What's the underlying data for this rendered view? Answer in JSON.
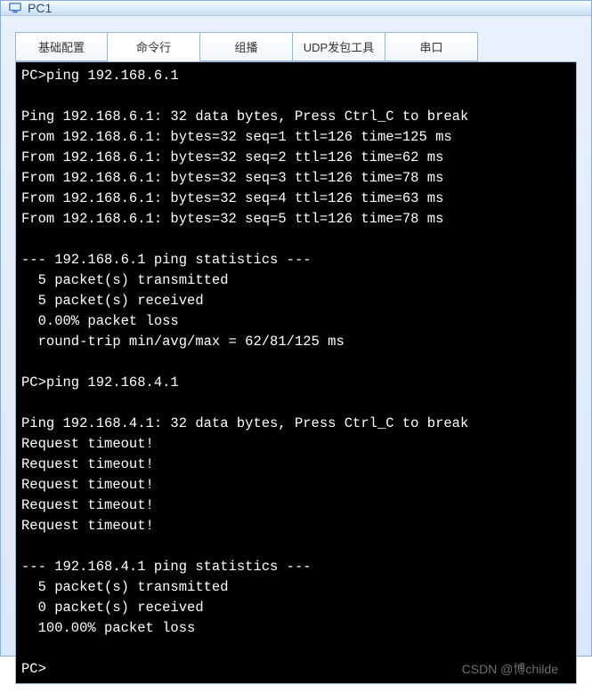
{
  "window": {
    "title": "PC1"
  },
  "tabs": [
    {
      "label": "基础配置",
      "active": false
    },
    {
      "label": "命令行",
      "active": true
    },
    {
      "label": "组播",
      "active": false
    },
    {
      "label": "UDP发包工具",
      "active": false
    },
    {
      "label": "串口",
      "active": false
    }
  ],
  "terminal": {
    "prompt": "PC>",
    "lines": [
      "PC>ping 192.168.6.1",
      "",
      "Ping 192.168.6.1: 32 data bytes, Press Ctrl_C to break",
      "From 192.168.6.1: bytes=32 seq=1 ttl=126 time=125 ms",
      "From 192.168.6.1: bytes=32 seq=2 ttl=126 time=62 ms",
      "From 192.168.6.1: bytes=32 seq=3 ttl=126 time=78 ms",
      "From 192.168.6.1: bytes=32 seq=4 ttl=126 time=63 ms",
      "From 192.168.6.1: bytes=32 seq=5 ttl=126 time=78 ms",
      "",
      "--- 192.168.6.1 ping statistics ---",
      "  5 packet(s) transmitted",
      "  5 packet(s) received",
      "  0.00% packet loss",
      "  round-trip min/avg/max = 62/81/125 ms",
      "",
      "PC>ping 192.168.4.1",
      "",
      "Ping 192.168.4.1: 32 data bytes, Press Ctrl_C to break",
      "Request timeout!",
      "Request timeout!",
      "Request timeout!",
      "Request timeout!",
      "Request timeout!",
      "",
      "--- 192.168.4.1 ping statistics ---",
      "  5 packet(s) transmitted",
      "  0 packet(s) received",
      "  100.00% packet loss",
      "",
      "PC>"
    ]
  },
  "watermark": "CSDN @博childe"
}
